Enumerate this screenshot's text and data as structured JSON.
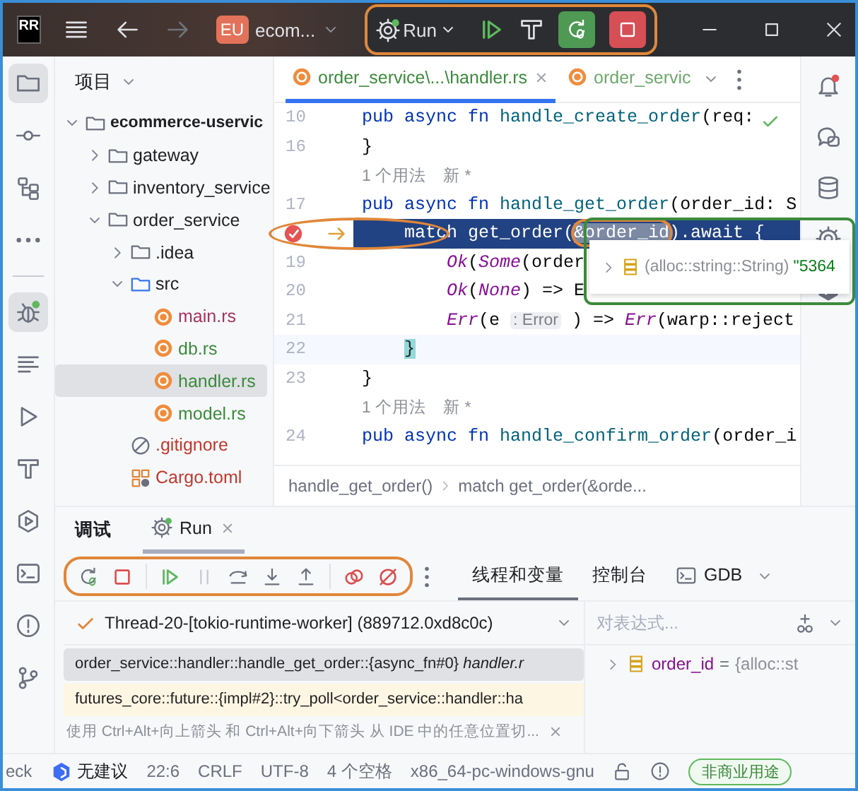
{
  "window": {
    "logo": "RR",
    "project_badge": "EU",
    "project_name": "ecom...",
    "run_config": "Run"
  },
  "nav_buttons": [
    {
      "kind": "back",
      "disabled": false
    },
    {
      "kind": "forward",
      "disabled": true
    }
  ],
  "run_toolbar": {
    "highlighted": true,
    "buttons": [
      {
        "kind": "resume"
      },
      {
        "kind": "build"
      },
      {
        "kind": "debug"
      },
      {
        "kind": "stop"
      }
    ]
  },
  "left_toolbar": [
    {
      "kind": "folder",
      "selected": true
    },
    {
      "kind": "commit",
      "selected": false
    },
    {
      "kind": "structure",
      "selected": false
    },
    {
      "kind": "more",
      "selected": false
    },
    {
      "kind": "bug",
      "selected": true
    },
    {
      "kind": "lines",
      "selected": false
    },
    {
      "kind": "run",
      "selected": false
    },
    {
      "kind": "build",
      "selected": false
    },
    {
      "kind": "services",
      "selected": false
    },
    {
      "kind": "terminal",
      "selected": false
    },
    {
      "kind": "problems",
      "selected": false
    },
    {
      "kind": "git",
      "selected": false
    }
  ],
  "project_panel": {
    "title": "项目",
    "tree": [
      {
        "label": "ecommerce-uservic",
        "kind": "folder",
        "expanded": true,
        "selected": false,
        "color": "#1e1f22",
        "children": [
          {
            "label": "gateway",
            "kind": "folder",
            "expanded": false,
            "selected": false,
            "color": "#1e1f22"
          },
          {
            "label": "inventory_service",
            "kind": "folder",
            "expanded": false,
            "selected": false,
            "color": "#1e1f22"
          },
          {
            "label": "order_service",
            "kind": "folder",
            "expanded": true,
            "selected": false,
            "color": "#1e1f22",
            "children": [
              {
                "label": ".idea",
                "kind": "folder",
                "expanded": false,
                "selected": false,
                "color": "#1e1f22"
              },
              {
                "label": "src",
                "kind": "source",
                "expanded": true,
                "selected": false,
                "color": "#1e1f22",
                "children": [
                  {
                    "label": "main.rs",
                    "kind": "rust",
                    "selected": false,
                    "color": "#a5345e"
                  },
                  {
                    "label": "db.rs",
                    "kind": "rust",
                    "selected": false,
                    "color": "#3c8a3c"
                  },
                  {
                    "label": "handler.rs",
                    "kind": "rust",
                    "selected": true,
                    "color": "#3c8a3c"
                  },
                  {
                    "label": "model.rs",
                    "kind": "rust",
                    "selected": false,
                    "color": "#3c8a3c"
                  }
                ]
              },
              {
                "label": ".gitignore",
                "kind": "ignore",
                "selected": false,
                "color": "#c0392b"
              },
              {
                "label": "Cargo.toml",
                "kind": "toml",
                "selected": false,
                "color": "#c0392b"
              }
            ]
          }
        ]
      }
    ]
  },
  "editor": {
    "tabs": [
      {
        "label": "order_service\\...\\handler.rs",
        "selected": true,
        "closable": true
      },
      {
        "label": "order_servic",
        "selected": false,
        "closable": false
      }
    ],
    "inspection_ok": true,
    "lines": [
      {
        "kind": "code",
        "number": "10",
        "tokens": [
          {
            "text": "pub async fn ",
            "kind": "kw"
          },
          {
            "text": "handle_create_order",
            "kind": "fn"
          },
          {
            "text": "(req:",
            "kind": "plain"
          }
        ]
      },
      {
        "kind": "code",
        "number": "16",
        "tokens": [
          {
            "text": "}",
            "kind": "plain"
          }
        ]
      },
      {
        "kind": "hint",
        "parts": [
          "1 个用法",
          "新 *"
        ]
      },
      {
        "kind": "code",
        "number": "17",
        "tokens": [
          {
            "text": "pub async fn ",
            "kind": "kw"
          },
          {
            "text": "handle_get_order",
            "kind": "fn"
          },
          {
            "text": "(order_id: S",
            "kind": "plain"
          }
        ]
      },
      {
        "kind": "code",
        "breakpoint": true,
        "current": true,
        "circled": true,
        "tokens": [
          {
            "text": "    match ",
            "kind": "kw"
          },
          {
            "text": "get_order(",
            "kind": "plain"
          },
          {
            "text": "&order_id",
            "kind": "hovered"
          },
          {
            "text": ").await {",
            "kind": "plain"
          }
        ],
        "popup": {
          "outlined": true,
          "type": "(alloc::string::String)",
          "value": "\"5364"
        }
      },
      {
        "kind": "code",
        "number": "19",
        "tokens": [
          {
            "text": "        Ok",
            "kind": "variant"
          },
          {
            "text": "(",
            "kind": "plain"
          },
          {
            "text": "Some",
            "kind": "variant"
          },
          {
            "text": "(order",
            "kind": "plain"
          }
        ]
      },
      {
        "kind": "code",
        "number": "20",
        "tokens": [
          {
            "text": "        Ok",
            "kind": "variant"
          },
          {
            "text": "(",
            "kind": "plain"
          },
          {
            "text": "None",
            "kind": "variant"
          },
          {
            "text": ") => E",
            "kind": "plain"
          }
        ]
      },
      {
        "kind": "code",
        "number": "21",
        "tokens": [
          {
            "text": "        Err",
            "kind": "variant"
          },
          {
            "text": "(e ",
            "kind": "plain"
          },
          {
            "text": ": Error",
            "kind": "inlay"
          },
          {
            "text": " ) => ",
            "kind": "plain"
          },
          {
            "text": "Err",
            "kind": "variant"
          },
          {
            "text": "(warp::reject",
            "kind": "plain"
          }
        ]
      },
      {
        "kind": "code",
        "number": "22",
        "caret": true,
        "tokens": [
          {
            "text": "    }",
            "kind": "brace"
          }
        ]
      },
      {
        "kind": "code",
        "number": "23",
        "tokens": [
          {
            "text": "}",
            "kind": "plain"
          }
        ]
      },
      {
        "kind": "hint",
        "parts": [
          "1 个用法",
          "新 *"
        ]
      },
      {
        "kind": "code",
        "number": "24",
        "tokens": [
          {
            "text": "pub async fn ",
            "kind": "kw"
          },
          {
            "text": "handle_confirm_order",
            "kind": "fn"
          },
          {
            "text": "(order_i",
            "kind": "plain"
          }
        ]
      }
    ],
    "breadcrumbs": [
      "handle_get_order()",
      "match get_order(&orde..."
    ]
  },
  "right_toolbar": [
    {
      "kind": "bell"
    },
    {
      "kind": "chat"
    },
    {
      "kind": "database"
    },
    {
      "kind": "gear"
    },
    {
      "kind": "plugin"
    }
  ],
  "debug_panel": {
    "title": "调试",
    "tabs": [
      {
        "label": "Run",
        "selected": true,
        "closable": true
      }
    ],
    "toolbar": {
      "highlighted": true,
      "buttons": [
        {
          "kind": "rerun",
          "disabled": false
        },
        {
          "kind": "stop",
          "disabled": false
        },
        {
          "kind": "resume",
          "disabled": false
        },
        {
          "kind": "pause",
          "disabled": true
        },
        {
          "kind": "step_over",
          "disabled": false
        },
        {
          "kind": "step_into",
          "disabled": false
        },
        {
          "kind": "step_out",
          "disabled": false
        },
        {
          "kind": "view_breakpoints",
          "disabled": false
        },
        {
          "kind": "mute_breakpoints",
          "disabled": false
        }
      ]
    },
    "view_tabs": [
      {
        "label": "线程和变量",
        "selected": true,
        "kind": "plain"
      },
      {
        "label": "控制台",
        "selected": false,
        "kind": "plain"
      },
      {
        "label": "GDB",
        "selected": false,
        "kind": "terminal"
      }
    ],
    "thread": "Thread-20-[tokio-runtime-worker] (889712.0xd8c0c)",
    "frames": [
      {
        "text": "order_service::handler::handle_get_order::{async_fn#0} *handler.r*",
        "selected": true,
        "kind": "user"
      },
      {
        "text": "futures_core::future::{impl#2}::try_poll<order_service::handler::ha",
        "selected": false,
        "kind": "library"
      }
    ],
    "hint": "使用 Ctrl+Alt+向上箭头 和 Ctrl+Alt+向下箭头 从 IDE 中的任意位置切...",
    "expression": {
      "placeholder": "对表达式..."
    },
    "variables": [
      {
        "name": "order_id",
        "op": "=",
        "value": "{alloc::st"
      }
    ]
  },
  "status_bar": {
    "cut_left": "eck",
    "assistant": "无建议",
    "items": [
      "22:6",
      "CRLF",
      "UTF-8",
      "4 个空格",
      "x86_64-pc-windows-gnu"
    ],
    "license": "非商业用途"
  }
}
